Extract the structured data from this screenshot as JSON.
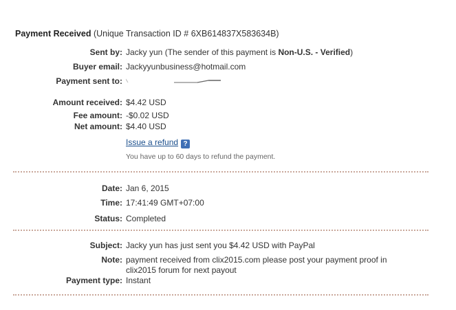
{
  "header": {
    "title_bold": "Payment Received",
    "title_rest": " (Unique Transaction ID # 6XB614837X583634B)"
  },
  "sender": {
    "label": "Sent by:",
    "name": "Jacky yun",
    "note_prefix": " (The sender of this payment is ",
    "status": "Non-U.S. - Verified",
    "note_suffix": ")"
  },
  "buyer_email": {
    "label": "Buyer email:",
    "value": "Jackyyunbusiness@hotmail.com"
  },
  "payment_sent_to": {
    "label": "Payment sent to:"
  },
  "amount_received": {
    "label": "Amount received:",
    "value": "$4.42 USD"
  },
  "fee_amount": {
    "label": "Fee amount:",
    "value": "-$0.02 USD"
  },
  "net_amount": {
    "label": "Net amount:",
    "value": "$4.40 USD"
  },
  "refund": {
    "link_label": "Issue a refund",
    "help_glyph": "?",
    "note": "You have up to 60 days to refund the payment."
  },
  "date": {
    "label": "Date:",
    "value": "Jan 6, 2015"
  },
  "time": {
    "label": "Time:",
    "value": "17:41:49 GMT+07:00"
  },
  "status": {
    "label": "Status:",
    "value": "Completed"
  },
  "subject": {
    "label": "Subject:",
    "value": "Jacky yun has just sent you $4.42 USD with PayPal"
  },
  "note": {
    "label": "Note:",
    "value": "payment received from clix2015.com please post your payment proof in clix2015 forum for next payout"
  },
  "payment_type": {
    "label": "Payment type:",
    "value": "Instant"
  },
  "colors": {
    "link": "#1a4e8c",
    "help_icon": "#3f6fb5",
    "divider": "#c9a79a"
  }
}
